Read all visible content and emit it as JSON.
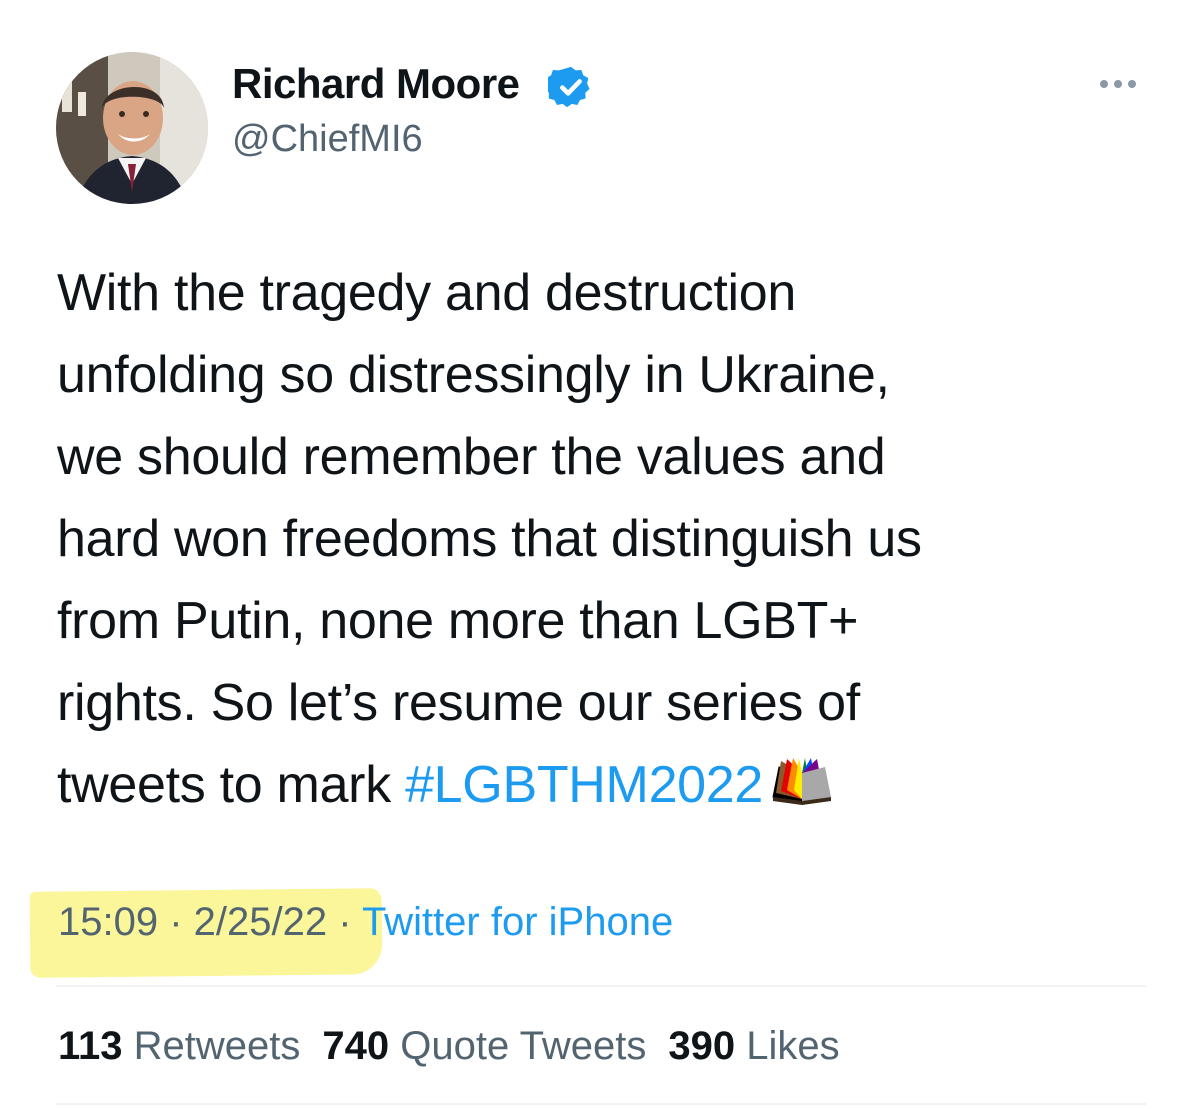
{
  "author": {
    "name": "Richard Moore",
    "handle": "@ChiefMI6",
    "verified": true
  },
  "tweet": {
    "lines": [
      "With the tragedy and destruction",
      "unfolding so distressingly in Ukraine,",
      "we should remember the values and",
      "hard won freedoms that distinguish us",
      "from Putin, none more than LGBT+",
      "rights. So let’s resume our series of"
    ],
    "last_line_prefix": "tweets to mark ",
    "hashtag": "#LGBTHM2022",
    "emoji_icon": "rainbow-book-icon"
  },
  "meta": {
    "time": "15:09",
    "date": "2/25/22",
    "separator": " · ",
    "source": "Twitter for iPhone"
  },
  "stats": {
    "retweets_count": "113",
    "retweets_label": "Retweets",
    "quotes_count": "740",
    "quotes_label": "Quote Tweets",
    "likes_count": "390",
    "likes_label": "Likes"
  },
  "icons": {
    "verified": "verified-badge-icon",
    "more": "more-options-icon"
  },
  "colors": {
    "link": "#1d9bf0",
    "secondary_text": "#536471",
    "highlight": "#fcf69a"
  }
}
